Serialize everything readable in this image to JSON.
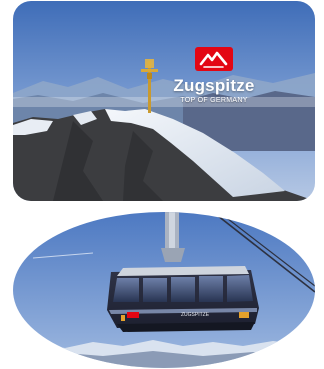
{
  "images": {
    "top": {
      "subject": "mountain summit with golden cross",
      "brand": "Zugspitze",
      "tagline": "TOP OF GERMANY"
    },
    "bottom": {
      "subject": "cable car gondola",
      "cabin_text": "ZUGSPITZE"
    }
  },
  "colors": {
    "sky": "#5d84c4",
    "brand_red": "#e30613",
    "snow": "#eef2f7",
    "rock": "#3c3d40"
  }
}
